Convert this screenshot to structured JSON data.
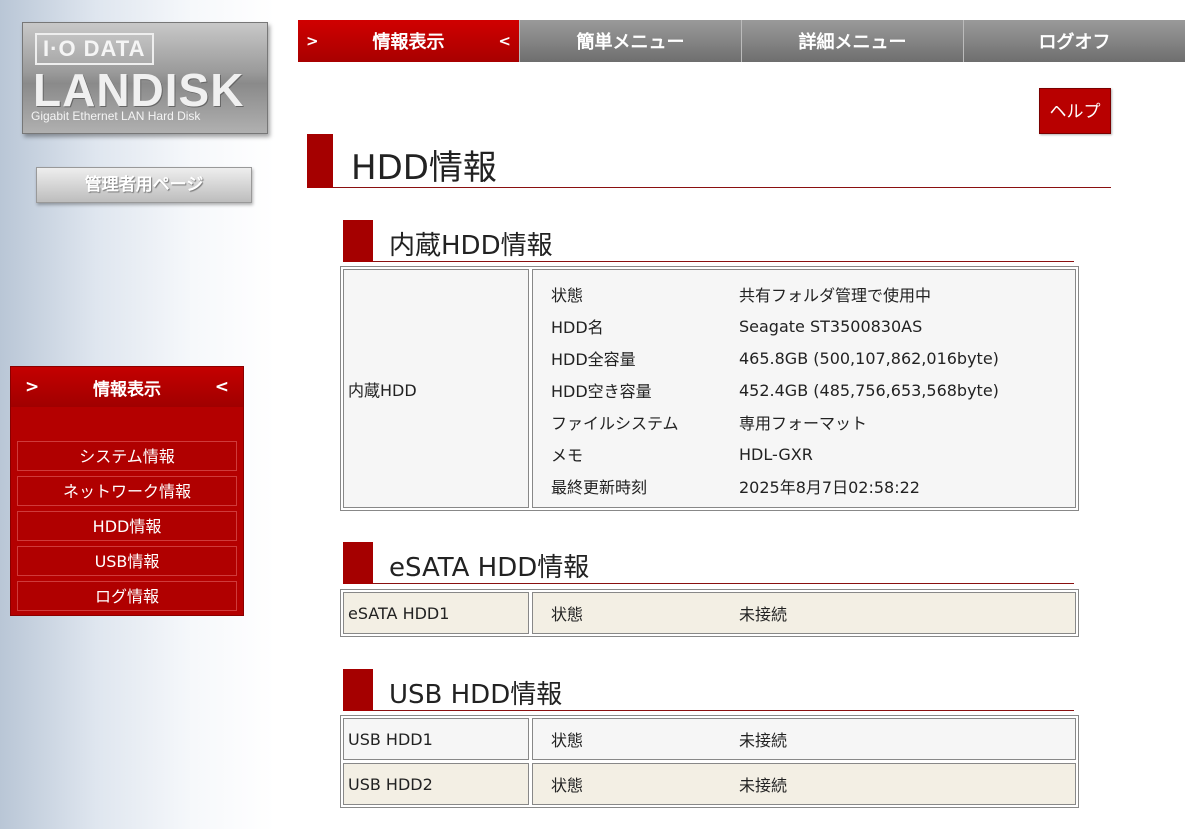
{
  "logo": {
    "brand": "I·O DATA",
    "product": "LANDISK",
    "tagline": "Gigabit Ethernet LAN Hard Disk"
  },
  "admin_button": "管理者用ページ",
  "side_menu": {
    "title": "情報表示",
    "arrow_left": ">",
    "arrow_right": "<",
    "items": [
      "システム情報",
      "ネットワーク情報",
      "HDD情報",
      "USB情報",
      "ログ情報"
    ]
  },
  "topnav": {
    "tabs": [
      "情報表示",
      "簡単メニュー",
      "詳細メニュー",
      "ログオフ"
    ],
    "active_arrow_left": ">",
    "active_arrow_right": "<"
  },
  "help_button": "ヘルプ",
  "page_title": "HDD情報",
  "internal": {
    "section_title": "内蔵HDD情報",
    "row_label": "内蔵HDD",
    "fields": [
      {
        "k": "状態",
        "v": "共有フォルダ管理で使用中"
      },
      {
        "k": "HDD名",
        "v": "Seagate ST3500830AS"
      },
      {
        "k": "HDD全容量",
        "v": "465.8GB (500,107,862,016byte)"
      },
      {
        "k": "HDD空き容量",
        "v": "452.4GB (485,756,653,568byte)"
      },
      {
        "k": "ファイルシステム",
        "v": "専用フォーマット"
      },
      {
        "k": "メモ",
        "v": "HDL-GXR"
      },
      {
        "k": "最終更新時刻",
        "v": "2025年8月7日02:58:22"
      }
    ]
  },
  "esata": {
    "section_title": "eSATA HDD情報",
    "rows": [
      {
        "label": "eSATA HDD1",
        "k": "状態",
        "v": "未接続"
      }
    ]
  },
  "usb": {
    "section_title": "USB HDD情報",
    "rows": [
      {
        "label": "USB HDD1",
        "k": "状態",
        "v": "未接続"
      },
      {
        "label": "USB HDD2",
        "k": "状態",
        "v": "未接続"
      }
    ]
  },
  "colors": {
    "accent_red": "#b40000",
    "nav_gray": "#808080",
    "row_beige": "#f3efe4"
  }
}
